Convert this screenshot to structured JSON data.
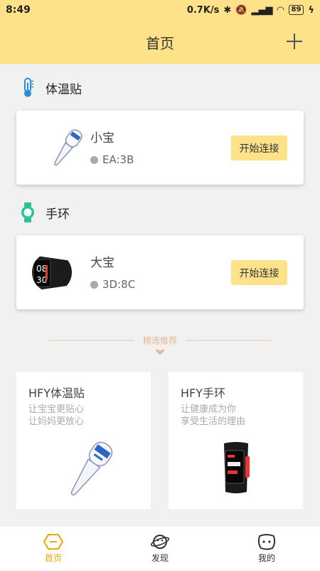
{
  "status": {
    "time": "8:49",
    "speed": "0.7K/s",
    "battery": "89"
  },
  "header": {
    "title": "首页"
  },
  "sections": [
    {
      "title": "体温贴",
      "icon": "thermometer-icon",
      "device": {
        "name": "小宝",
        "id": "EA:3B",
        "button": "开始连接"
      }
    },
    {
      "title": "手环",
      "icon": "watch-icon",
      "device": {
        "name": "大宝",
        "id": "3D:8C",
        "button": "开始连接"
      }
    }
  ],
  "divider": {
    "label": "精选推荐"
  },
  "products": [
    {
      "title": "HFY体温贴",
      "line1": "让宝宝更贴心",
      "line2": "让妈妈更放心"
    },
    {
      "title": "HFY手环",
      "line1": "让健康成为你",
      "line2": "享受生活的理由"
    }
  ],
  "band_display": {
    "top": "08",
    "bottom": "30"
  },
  "tabs": [
    {
      "label": "首页",
      "icon": "home-hex-icon",
      "active": true
    },
    {
      "label": "发现",
      "icon": "planet-icon",
      "active": false
    },
    {
      "label": "我的",
      "icon": "smiley-icon",
      "active": false
    }
  ],
  "colors": {
    "accent": "#fde28a",
    "active_tab": "#f0a500",
    "divider": "#f4c7a0"
  }
}
